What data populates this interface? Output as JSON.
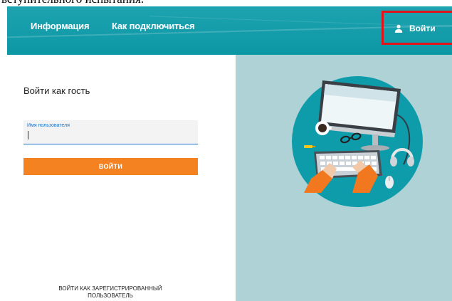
{
  "cropped_caption": "вступительного испытания.",
  "header": {
    "nav": [
      {
        "label": "Информация"
      },
      {
        "label": "Как подключиться"
      }
    ],
    "login_label": "Войти",
    "login_icon": "user-icon",
    "highlight_color": "#e0151c",
    "bg_color": "#0c97a5"
  },
  "form": {
    "title": "Войти как гость",
    "username_label": "Имя пользователя",
    "username_value": "",
    "submit_label": "ВОЙТИ",
    "submit_color": "#f58220",
    "registered_link": "ВОЙТИ КАК ЗАРЕГИСТРИРОВАННЫЙ ПОЛЬЗОВАТЕЛЬ"
  },
  "illustration": {
    "description_icon": "laptop-workspace-illustration"
  }
}
